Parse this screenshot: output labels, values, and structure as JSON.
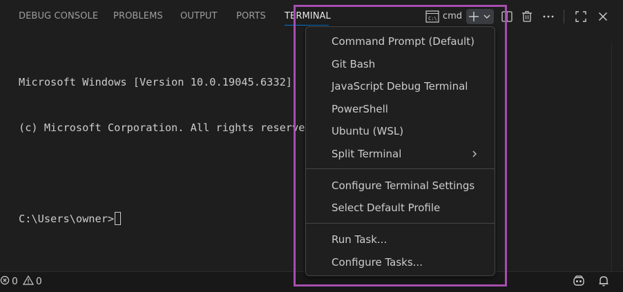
{
  "tabs": [
    {
      "label": "DEBUG CONSOLE"
    },
    {
      "label": "PROBLEMS"
    },
    {
      "label": "OUTPUT"
    },
    {
      "label": "PORTS"
    },
    {
      "label": "TERMINAL",
      "active": true
    }
  ],
  "toolbar": {
    "terminal_name": "cmd",
    "icons": [
      "terminal-icon",
      "plus-icon",
      "chevron-down-icon",
      "split-icon",
      "trash-icon",
      "more-icon",
      "maximize-icon",
      "close-icon"
    ]
  },
  "terminal": {
    "lines": [
      "Microsoft Windows [Version 10.0.19045.6332]",
      "(c) Microsoft Corporation. All rights reserved.",
      "",
      "C:\\Users\\owner>"
    ]
  },
  "menu": {
    "items": [
      {
        "label": "Command Prompt (Default)"
      },
      {
        "label": "Git Bash"
      },
      {
        "label": "JavaScript Debug Terminal"
      },
      {
        "label": "PowerShell"
      },
      {
        "label": "Ubuntu (WSL)"
      },
      {
        "label": "Split Terminal",
        "submenu": true
      },
      {
        "label": "Configure Terminal Settings"
      },
      {
        "label": "Select Default Profile"
      },
      {
        "label": "Run Task..."
      },
      {
        "label": "Configure Tasks..."
      }
    ]
  },
  "status": {
    "errors": "0",
    "warnings": "0"
  },
  "colors": {
    "background": "#1e1e1e",
    "accent": "#0078d4",
    "highlight_border": "#a74eb0"
  }
}
